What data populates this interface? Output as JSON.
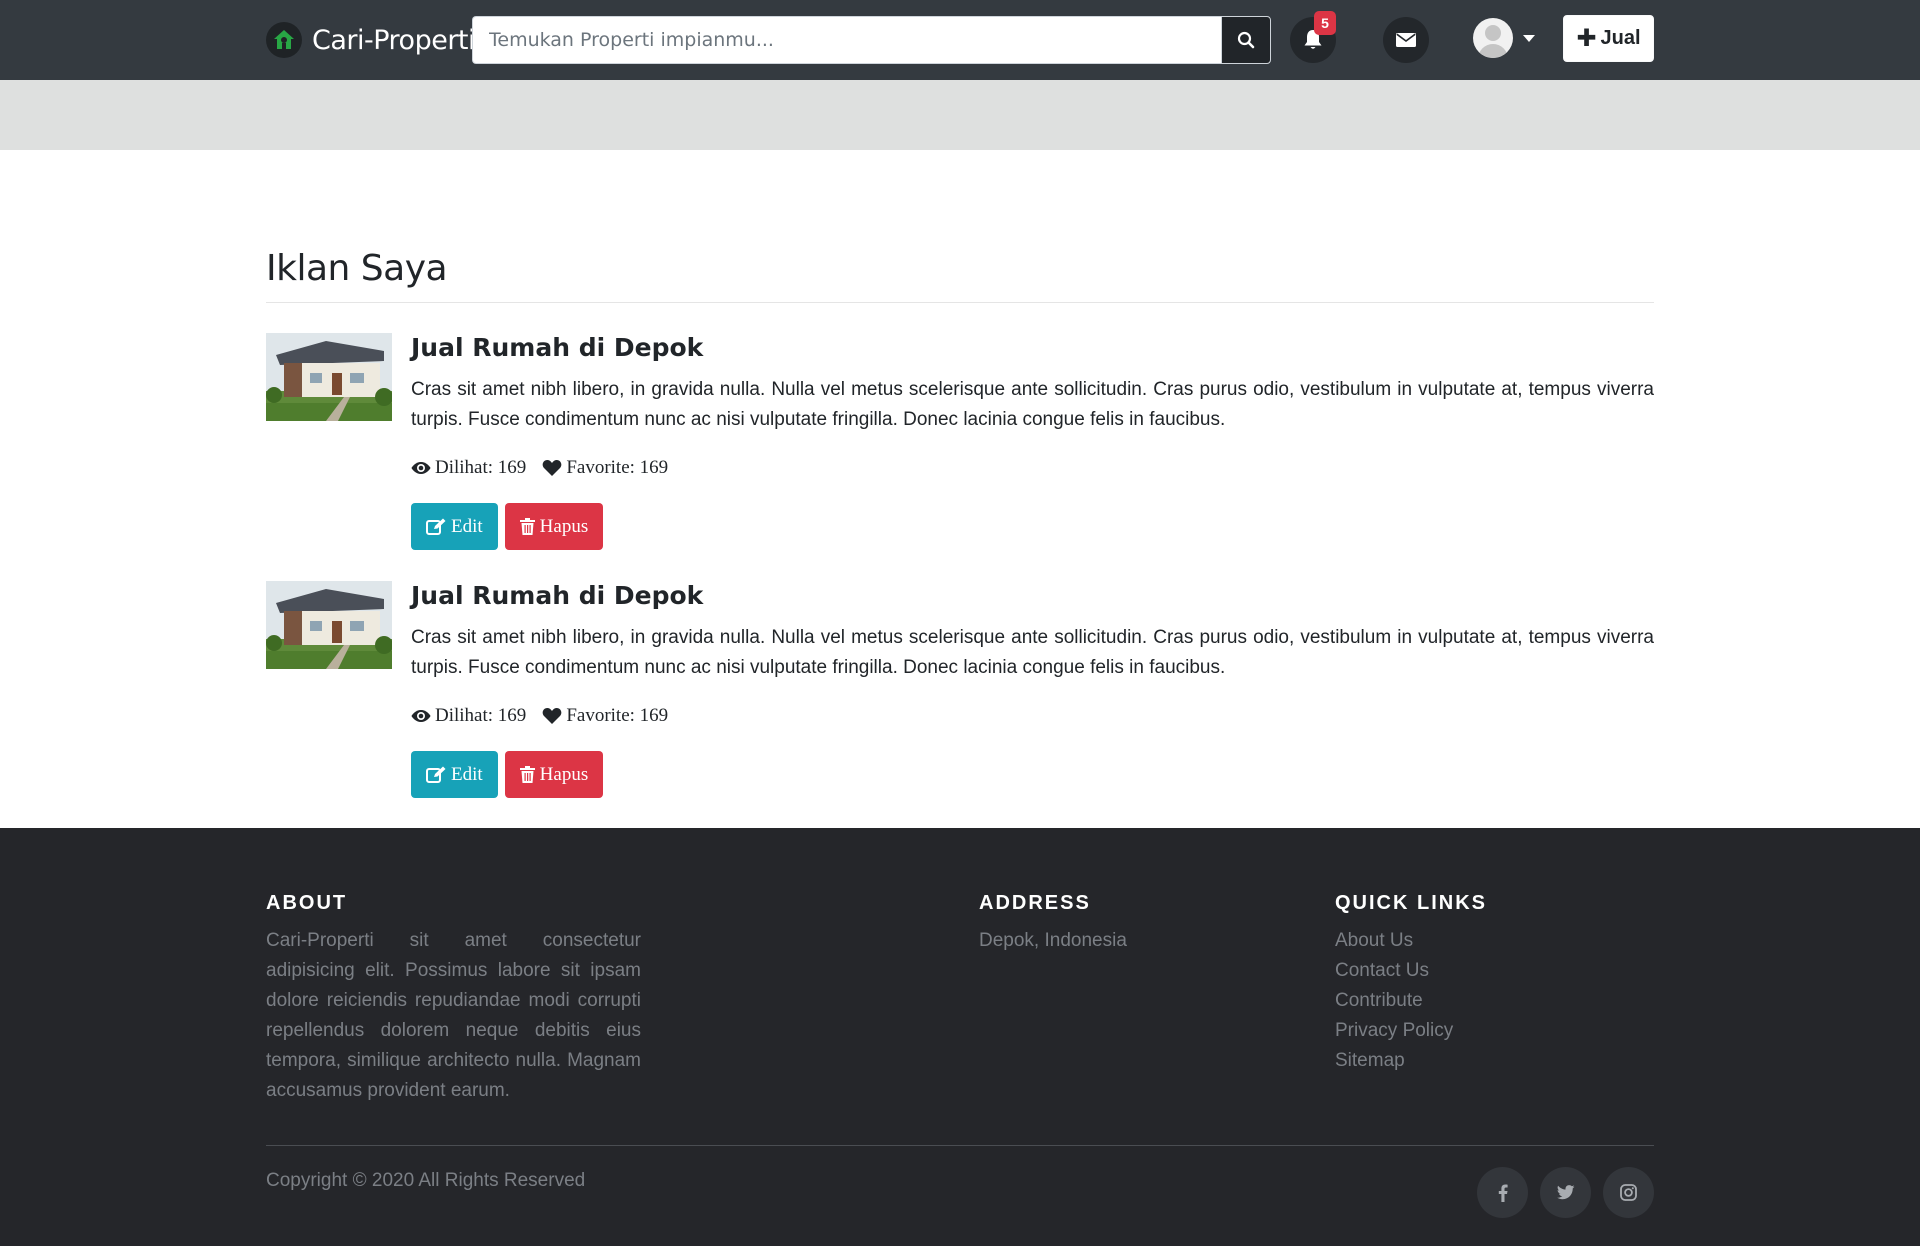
{
  "navbar": {
    "brand": "Cari-Properti",
    "search_placeholder": "Temukan Properti impianmu...",
    "notification_count": "5",
    "sell_label": "Jual",
    "icons": {
      "logo": "home-icon",
      "search": "search-icon",
      "notifications": "bell-icon",
      "messages": "envelope-icon",
      "user": "user-avatar-icon",
      "sell": "plus-icon"
    }
  },
  "main": {
    "title": "Iklan Saya",
    "listings": [
      {
        "title": "Jual Rumah di Depok",
        "description": "Cras sit amet nibh libero, in gravida nulla. Nulla vel metus scelerisque ante sollicitudin. Cras purus odio, vestibulum in vulputate at, tempus viverra turpis. Fusce condimentum nunc ac nisi vulputate fringilla. Donec lacinia congue felis in faucibus.",
        "views_label": "Dilihat: 169",
        "favorites_label": "Favorite: 169",
        "edit_label": "Edit",
        "delete_label": "Hapus"
      },
      {
        "title": "Jual Rumah di Depok",
        "description": "Cras sit amet nibh libero, in gravida nulla. Nulla vel metus scelerisque ante sollicitudin. Cras purus odio, vestibulum in vulputate at, tempus viverra turpis. Fusce condimentum nunc ac nisi vulputate fringilla. Donec lacinia congue felis in faucibus.",
        "views_label": "Dilihat: 169",
        "favorites_label": "Favorite: 169",
        "edit_label": "Edit",
        "delete_label": "Hapus"
      }
    ]
  },
  "footer": {
    "about_heading": "ABOUT",
    "about_text": "Cari-Properti sit amet consectetur adipisicing elit. Possimus labore sit ipsam dolore reiciendis repudiandae modi corrupti repellendus dolorem neque debitis eius tempora, similique architecto nulla. Magnam accusamus provident earum.",
    "address_heading": "ADDRESS",
    "address_text": "Depok, Indonesia",
    "links_heading": "QUICK LINKS",
    "links": [
      "About Us",
      "Contact Us",
      "Contribute",
      "Privacy Policy",
      "Sitemap"
    ],
    "copyright": "Copyright © 2020 All Rights Reserved",
    "social_icons": [
      "facebook-icon",
      "twitter-icon",
      "instagram-icon"
    ]
  },
  "colors": {
    "navbar_bg": "#343a40",
    "band_bg": "#dee0df",
    "edit_button": "#17a2b8",
    "delete_button": "#dc3545",
    "badge": "#dc3545",
    "footer_bg": "#25262a",
    "footer_text": "#7b7f85"
  }
}
